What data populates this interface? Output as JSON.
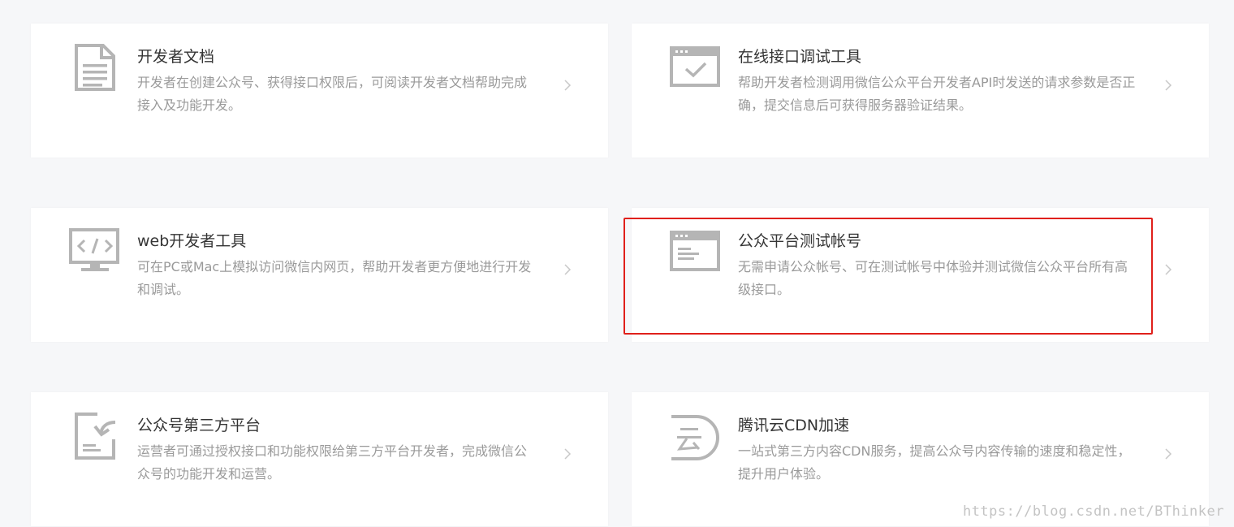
{
  "cards": [
    {
      "icon": "document-icon",
      "title": "开发者文档",
      "desc": "开发者在创建公众号、获得接口权限后，可阅读开发者文档帮助完成接入及功能开发。"
    },
    {
      "icon": "checkmark-window-icon",
      "title": "在线接口调试工具",
      "desc": "帮助开发者检测调用微信公众平台开发者API时发送的请求参数是否正确，提交信息后可获得服务器验证结果。"
    },
    {
      "icon": "code-monitor-icon",
      "title": "web开发者工具",
      "desc": "可在PC或Mac上模拟访问微信内网页，帮助开发者更方便地进行开发和调试。"
    },
    {
      "icon": "browser-window-icon",
      "title": "公众平台测试帐号",
      "desc": "无需申请公众帐号、可在测试帐号中体验并测试微信公众平台所有高级接口。"
    },
    {
      "icon": "third-party-document-icon",
      "title": "公众号第三方平台",
      "desc": "运营者可通过授权接口和功能权限给第三方平台开发者，完成微信公众号的功能开发和运营。"
    },
    {
      "icon": "cloud-cdn-icon",
      "title": "腾讯云CDN加速",
      "desc": "一站式第三方内容CDN服务，提高公众号内容传输的速度和稳定性，提升用户体验。"
    }
  ],
  "watermark": "https://blog.csdn.net/BThinker",
  "colors": {
    "background": "#f6f7f9",
    "card": "#ffffff",
    "title": "#353535",
    "description": "#9a9a9a",
    "icon": "#b5b5b5",
    "highlight": "#e0201b"
  }
}
